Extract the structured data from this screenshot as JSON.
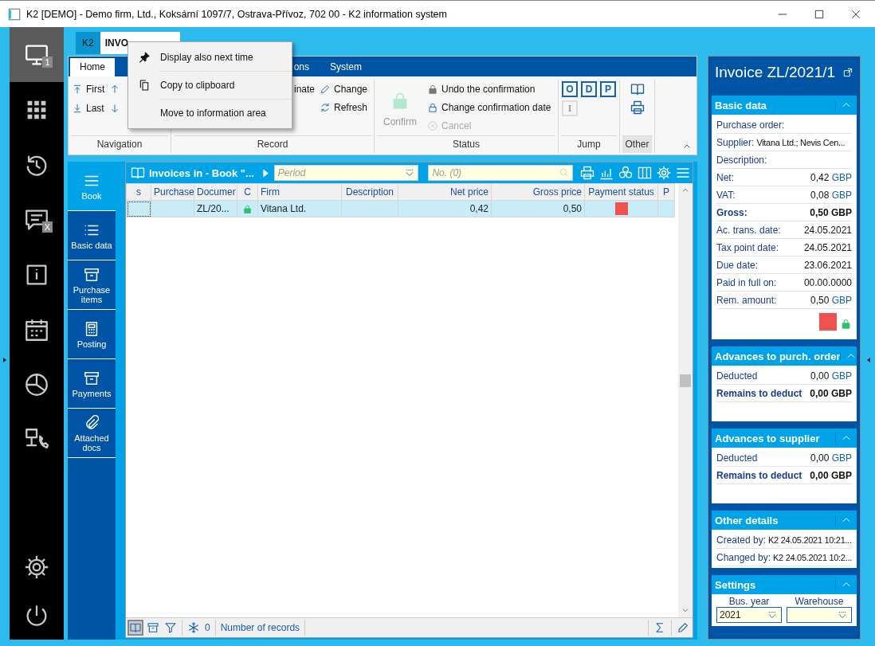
{
  "window": {
    "title": "K2 [DEMO] - Demo firm, Ltd., Koksární 1097/7, Ostrava-Přívoz, 702 00 - K2 information system"
  },
  "rail": {
    "items": [
      {
        "selected": true,
        "badge": "1"
      },
      {
        "selected": false
      },
      {
        "selected": false
      },
      {
        "selected": false,
        "badge": "X"
      },
      {
        "selected": false
      },
      {
        "selected": false
      },
      {
        "selected": false
      },
      {
        "selected": false
      }
    ],
    "bottom": [
      {
        "selected": false
      },
      {
        "selected": false
      }
    ]
  },
  "doc_tabs": [
    {
      "label": "K2",
      "selected": false
    },
    {
      "label": "INVO",
      "selected": true
    }
  ],
  "ribbon": {
    "tabs": [
      {
        "label": "Home",
        "selected": true
      },
      {
        "label": "ons",
        "selected": false
      },
      {
        "label": "System",
        "selected": false
      }
    ],
    "groups": [
      {
        "kind": "navigation",
        "label": "Navigation",
        "items": [
          {
            "label": "First"
          },
          {
            "label": "Last"
          }
        ]
      },
      {
        "kind": "record",
        "label": "Record",
        "items": [
          {
            "label": "inate"
          },
          {
            "label": "Change"
          },
          {
            "label": "Refresh"
          }
        ]
      },
      {
        "kind": "status",
        "label": "Status",
        "items": [
          {
            "label": "Confirm",
            "disabled": true
          },
          {
            "label": "Undo the confirmation",
            "disabled": false
          },
          {
            "label": "Change confirmation date",
            "disabled": false
          },
          {
            "label": "Cancel",
            "disabled": true
          }
        ]
      },
      {
        "kind": "jump",
        "label": "Jump",
        "items": [
          {
            "label": "O",
            "disabled": false
          },
          {
            "label": "D",
            "disabled": false
          },
          {
            "label": "P",
            "disabled": false
          },
          {
            "label": "I",
            "disabled": true
          }
        ]
      },
      {
        "kind": "other",
        "label": "Other",
        "selected": true
      }
    ]
  },
  "context_menu": {
    "items": [
      {
        "label": "Display also next time"
      },
      {
        "label": "Copy to clipboard"
      },
      {
        "label": "Move to information area"
      }
    ]
  },
  "side_nav": {
    "items": [
      {
        "label": "Book",
        "selected": true
      },
      {
        "label": "Basic data",
        "selected": false
      },
      {
        "label": "Purchase items",
        "selected": false
      },
      {
        "label": "Posting",
        "selected": false
      },
      {
        "label": "Payments",
        "selected": false
      },
      {
        "label": "Attached docs",
        "selected": false
      }
    ]
  },
  "grid": {
    "title": "Invoices in - Book \"...",
    "period": {
      "placeholder": "Period"
    },
    "number": {
      "placeholder": "No. (0)"
    },
    "columns": [
      "s",
      "Purchase",
      "Documer",
      "C",
      "Firm",
      "Description",
      "Net price",
      "Gross price",
      "Payment status",
      "P"
    ],
    "rows": [
      {
        "selected": true,
        "document": "ZL/20...",
        "confirmed": true,
        "firm": "Vitana Ltd.",
        "net_price": "0,42",
        "gross_price": "0,50",
        "color": "#ef5350"
      }
    ]
  },
  "status_bar": {
    "count": "0",
    "label": "Number of records"
  },
  "info_panel": {
    "title": "Invoice ZL/2021/1",
    "sections": [
      {
        "title": "Basic data",
        "expanded": true,
        "kind": "fields",
        "rows": [
          {
            "kind": "inline",
            "label": "Purchase order:"
          },
          {
            "kind": "inline",
            "label": "Supplier:",
            "value": "Vitana Ltd.; Nevis Cen..."
          },
          {
            "kind": "inline",
            "label": "Description:"
          },
          {
            "kind": "amount",
            "label": "Net:",
            "value": "0,42",
            "unit": "GBP",
            "bold": false
          },
          {
            "kind": "amount",
            "label": "VAT:",
            "value": "0,08",
            "unit": "GBP",
            "bold": false
          },
          {
            "kind": "amount",
            "label": "Gross:",
            "value": "0,50",
            "unit": "GBP",
            "bold": true
          },
          {
            "kind": "date",
            "label": "Ac. trans. date:",
            "value": "24.05.2021"
          },
          {
            "kind": "date",
            "label": "Tax point date:",
            "value": "24.05.2021"
          },
          {
            "kind": "date",
            "label": "Due date:",
            "value": "23.06.2021"
          },
          {
            "kind": "date",
            "label": "Paid in full on:",
            "value": "00.00.0000"
          },
          {
            "kind": "amount",
            "label": "Rem. amount:",
            "value": "0,50",
            "unit": "GBP",
            "bold": false
          }
        ],
        "color": "#ef5350",
        "confirmed": true
      },
      {
        "title": "Advances to purch. order",
        "expanded": true,
        "kind": "fields",
        "rows": [
          {
            "kind": "amount",
            "label": "Deducted",
            "value": "0,00",
            "unit": "GBP",
            "bold": false
          },
          {
            "kind": "amount",
            "label": "Remains to deduct",
            "value": "0,00",
            "unit": "GBP",
            "bold": true
          }
        ]
      },
      {
        "title": "Advances to supplier",
        "expanded": true,
        "kind": "fields",
        "rows": [
          {
            "kind": "amount",
            "label": "Deducted",
            "value": "0,00",
            "unit": "GBP",
            "bold": false
          },
          {
            "kind": "amount",
            "label": "Remains to deduct",
            "value": "0,00",
            "unit": "GBP",
            "bold": true
          }
        ]
      },
      {
        "title": "Other details",
        "expanded": true,
        "kind": "fields",
        "rows": [
          {
            "kind": "inline",
            "label": "Created by:",
            "value": "K2 24.05.2021 10:21..."
          },
          {
            "kind": "inline",
            "label": "Changed by:",
            "value": "K2 24.05.2021 10:2..."
          }
        ]
      },
      {
        "title": "Settings",
        "expanded": true,
        "kind": "settings",
        "fields": [
          {
            "label": "Bus. year",
            "value": "2021"
          },
          {
            "label": "Warehouse"
          }
        ]
      }
    ]
  }
}
